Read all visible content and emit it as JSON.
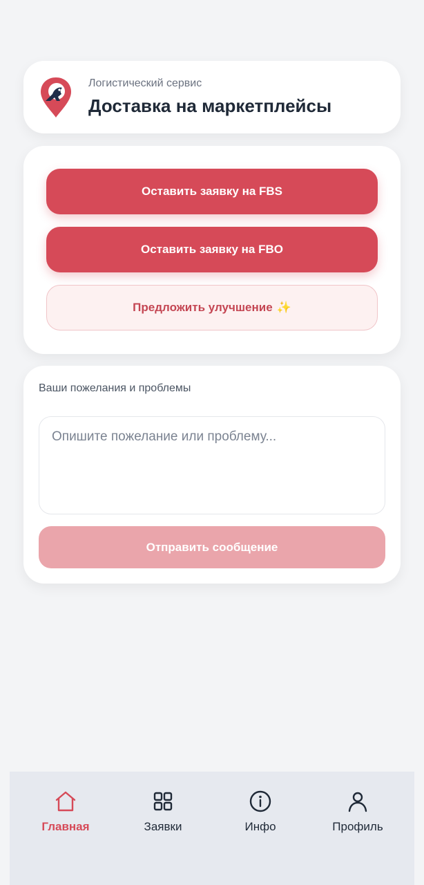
{
  "header": {
    "subtitle": "Логистический сервис",
    "title": "Доставка на маркетплейсы"
  },
  "actions": {
    "fbs_label": "Оставить заявку на FBS",
    "fbo_label": "Оставить заявку на FBO",
    "improve_label": "Предложить улучшение",
    "improve_emoji": "✨"
  },
  "feedback": {
    "label": "Ваши пожелания и проблемы",
    "placeholder": "Опишите пожелание или проблему...",
    "value": "",
    "send_label": "Отправить сообщение"
  },
  "nav": {
    "items": [
      {
        "label": "Главная",
        "icon": "home-icon",
        "active": true
      },
      {
        "label": "Заявки",
        "icon": "grid-icon",
        "active": false
      },
      {
        "label": "Инфо",
        "icon": "info-icon",
        "active": false
      },
      {
        "label": "Профиль",
        "icon": "user-icon",
        "active": false
      }
    ]
  },
  "colors": {
    "accent": "#d64a58",
    "accent_disabled": "#eaa5ab",
    "background": "#f3f4f6",
    "nav_background": "#e6e9ef"
  }
}
